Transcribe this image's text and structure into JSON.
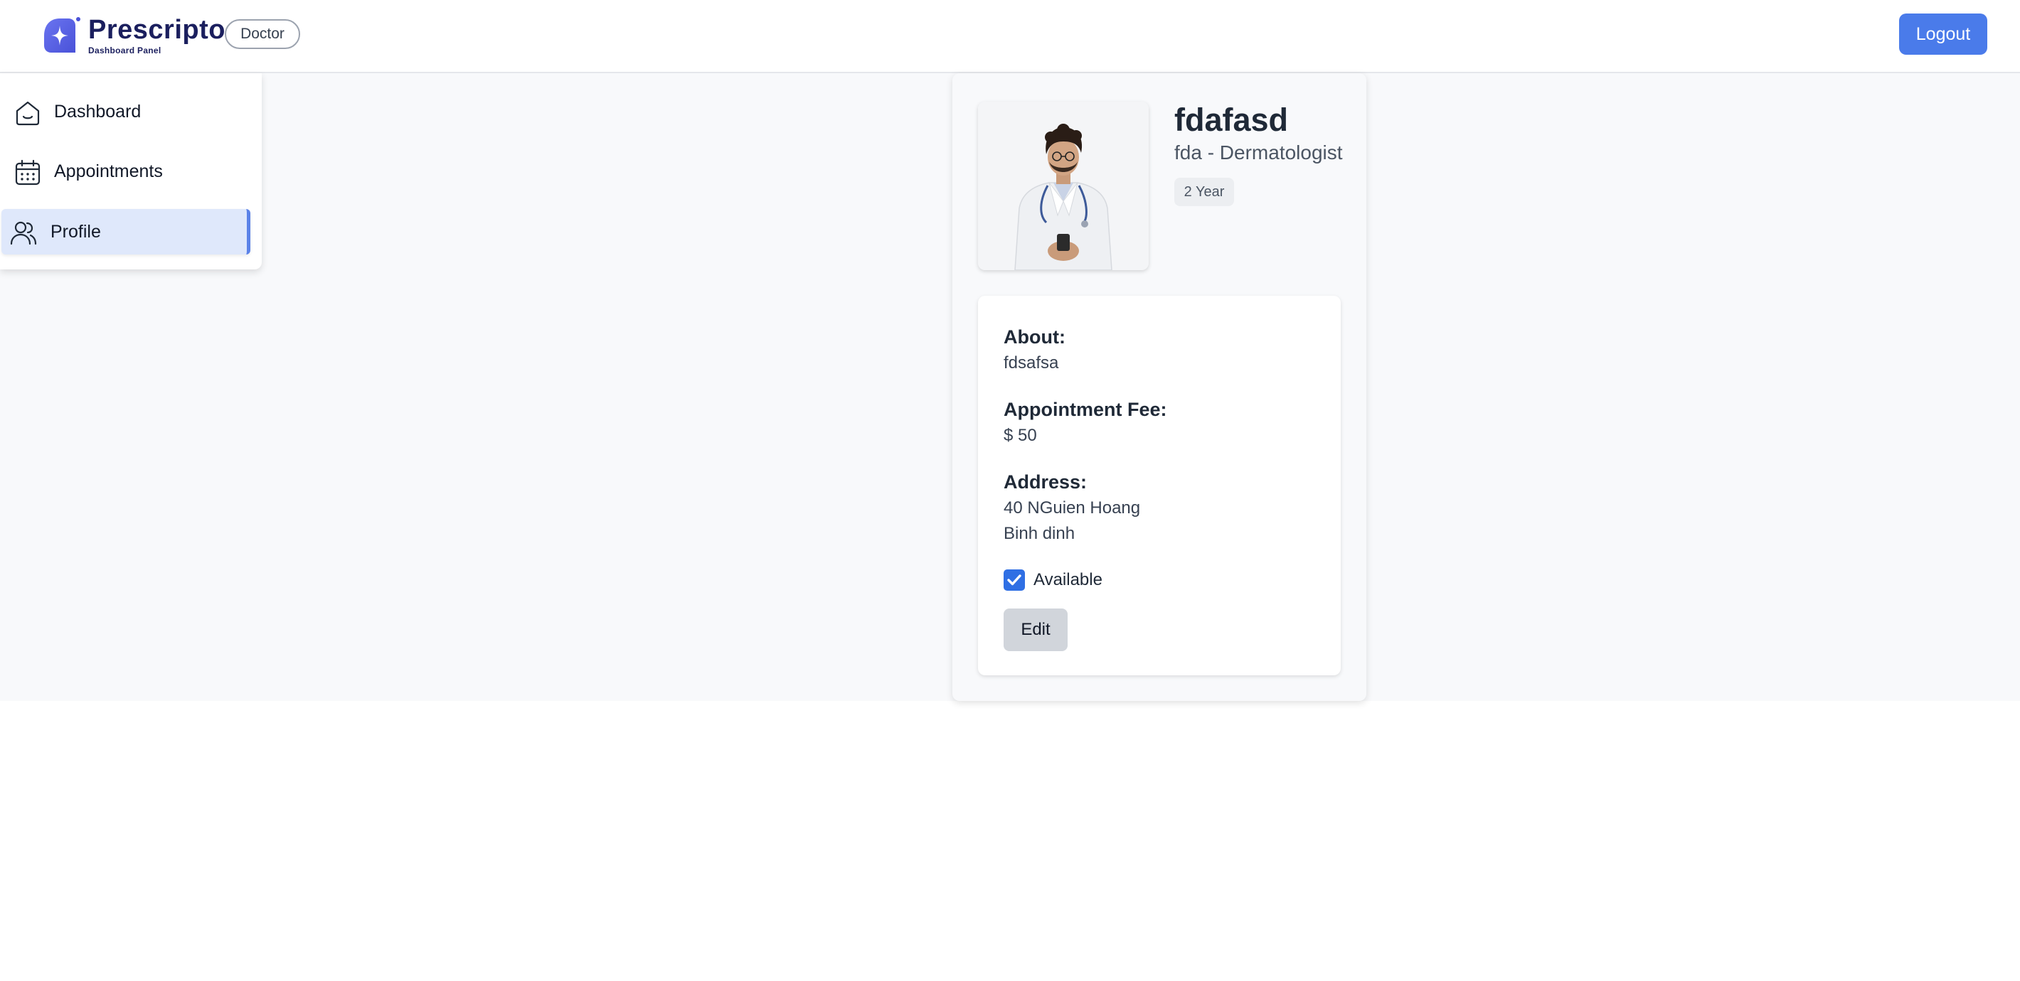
{
  "header": {
    "brand_name": "Prescripto",
    "brand_subtitle": "Dashboard Panel",
    "role_badge": "Doctor",
    "logout_label": "Logout",
    "logo_icon": "star-logo-icon"
  },
  "sidebar": {
    "items": [
      {
        "label": "Dashboard",
        "icon": "home-icon",
        "active": false
      },
      {
        "label": "Appointments",
        "icon": "calendar-icon",
        "active": false
      },
      {
        "label": "Profile",
        "icon": "people-icon",
        "active": true
      }
    ]
  },
  "profile": {
    "name": "fdafasd",
    "speciality_line": "fda - Dermatologist",
    "experience": "2 Year",
    "about_label": "About:",
    "about_text": "fdsafsa",
    "fee_label": "Appointment Fee:",
    "fee_value": "$ 50",
    "address_label": "Address:",
    "address_line1": "40 NGuien Hoang",
    "address_line2": "Binh dinh",
    "available_label": "Available",
    "available": true,
    "edit_label": "Edit"
  },
  "colors": {
    "accent": "#4a7bea",
    "brand_text": "#1b1f5e",
    "active_bg": "#dfe8fb",
    "checkbox": "#2f6fe4"
  }
}
